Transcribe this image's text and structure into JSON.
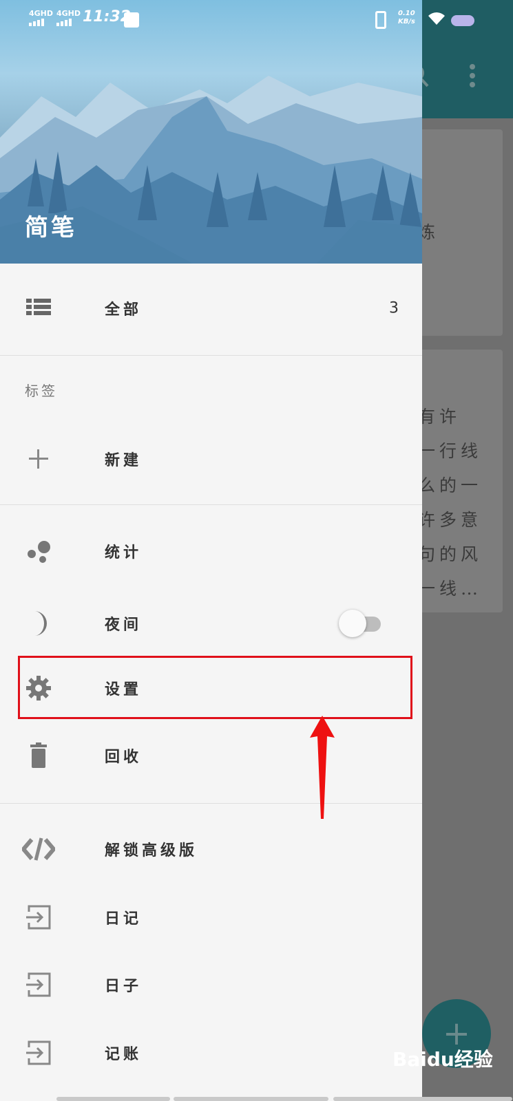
{
  "status_bar": {
    "sim1": "4GHD",
    "sim2": "4GHD",
    "time": "11:32",
    "speed_value": "0.10",
    "speed_unit": "KB/s"
  },
  "drawer": {
    "title": "简笔",
    "all_label": "全部",
    "all_count": "3",
    "tags_section": "标签",
    "new_label": "新建",
    "stats_label": "统计",
    "night_label": "夜间",
    "night_enabled": false,
    "settings_label": "设置",
    "recycle_label": "回收",
    "premium_label": "解锁高级版",
    "diary_label": "日记",
    "days_label": "日子",
    "accounting_label": "记账"
  },
  "background_app": {
    "card1_text": "炼",
    "card2_lines": [
      "有许",
      "一行线",
      "么的一",
      "许多意",
      "句的风",
      "一线…"
    ]
  },
  "watermark": "Baidu经验",
  "colors": {
    "toolbar": "#1f5d63",
    "highlight": "#e0101a"
  }
}
